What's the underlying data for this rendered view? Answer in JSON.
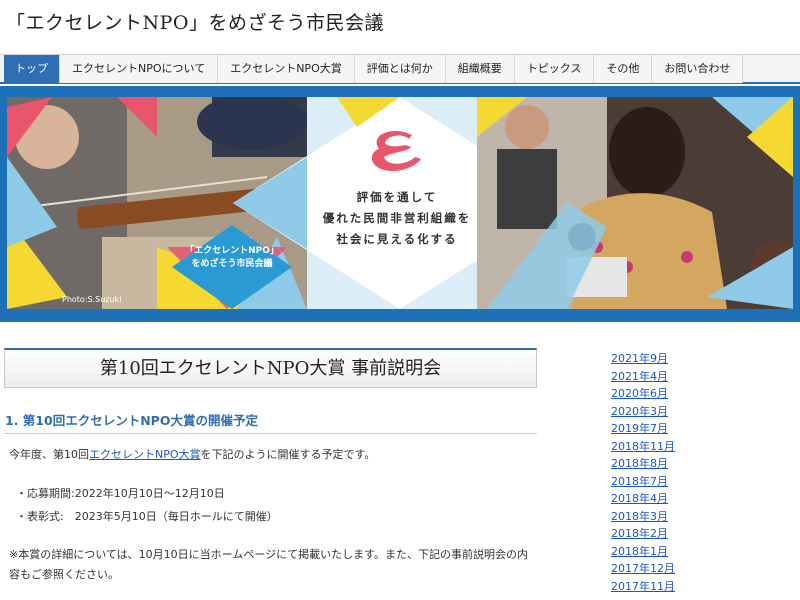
{
  "site": {
    "title": "「エクセレントNPO」をめざそう市民会議"
  },
  "nav": {
    "items": [
      {
        "label": "トップ"
      },
      {
        "label": "エクセレントNPOについて"
      },
      {
        "label": "エクセレントNPO大賞"
      },
      {
        "label": "評価とは何か"
      },
      {
        "label": "組織概要"
      },
      {
        "label": "トピックス"
      },
      {
        "label": "その他"
      },
      {
        "label": "お問い合わせ"
      }
    ]
  },
  "hero": {
    "tagline_1": "評価を通して",
    "tagline_2": "優れた民間非営利組織を",
    "tagline_3": "社会に見える化する",
    "badge_line_1": "「エクセレントNPO」",
    "badge_line_2": "をめざそう市民会議",
    "photo_credit": "Photo:S.Suzuki",
    "colors": {
      "band": "#1d71b8",
      "pink": "#e8566e",
      "yellow": "#f5d832",
      "lightblue": "#8fcbe8"
    }
  },
  "main": {
    "heading": "第10回エクセレントNPO大賞 事前説明会",
    "section_1_title": "1. 第10回エクセレントNPO大賞の開催予定",
    "intro_before": "今年度、第10回",
    "intro_link": "エクセレントNPO大賞",
    "intro_after": "を下記のように開催する予定です。",
    "detail_1": "・応募期間:2022年10月10日～12月10日",
    "detail_2": "・表彰式:　2023年5月10日（毎日ホールにて開催）",
    "note": "※本賞の詳細については、10月10日に当ホームページにて掲載いたします。また、下記の事前説明会の内容もご参照ください。"
  },
  "sidebar": {
    "archives": [
      "2021年9月",
      "2021年4月",
      "2020年6月",
      "2020年3月",
      "2019年7月",
      "2018年11月",
      "2018年8月",
      "2018年7月",
      "2018年4月",
      "2018年3月",
      "2018年2月",
      "2018年1月",
      "2017年12月",
      "2017年11月"
    ]
  }
}
